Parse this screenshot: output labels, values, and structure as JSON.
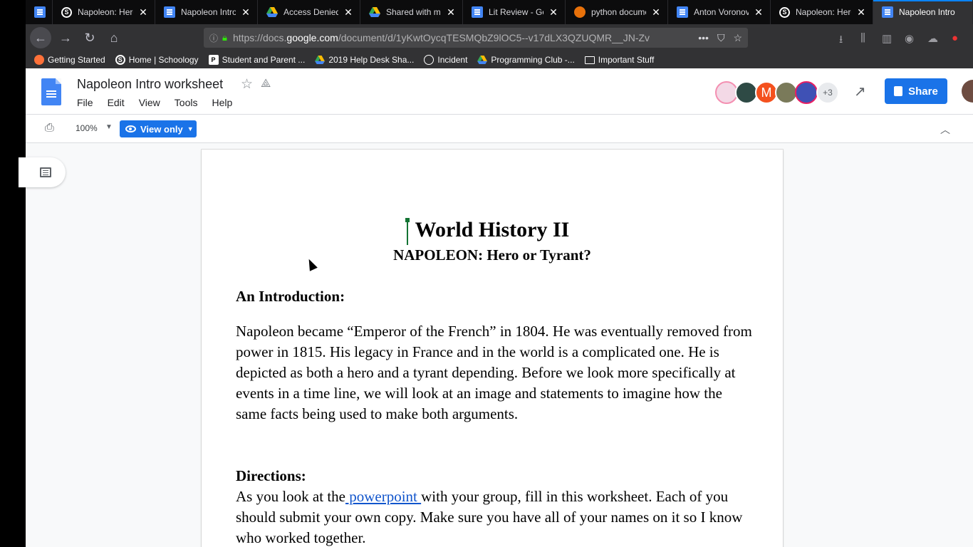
{
  "browser": {
    "tabs": [
      {
        "label": "",
        "icon": "docs-icon"
      },
      {
        "label": "Napoleon: Hero",
        "icon": "schoology-icon"
      },
      {
        "label": "Napoleon Intro",
        "icon": "docs-icon"
      },
      {
        "label": "Access Denied",
        "icon": "drive-icon"
      },
      {
        "label": "Shared with me",
        "icon": "drive-icon"
      },
      {
        "label": "Lit Review - Go",
        "icon": "docs-icon"
      },
      {
        "label": "python docume",
        "icon": "python-icon"
      },
      {
        "label": "Anton Voronov",
        "icon": "docs-icon"
      },
      {
        "label": "Napoleon: Hero",
        "icon": "schoology-icon"
      },
      {
        "label": "Napoleon Intro",
        "icon": "docs-icon"
      }
    ],
    "url_prefix": "https://docs.",
    "url_domain": "google.com",
    "url_rest": "/document/d/1yKwtOycqTESMQbZ9lOC5--v17dLX3QZUQMR__JN-Zv",
    "bookmarks": [
      "Getting Started",
      "Home | Schoology",
      "Student and Parent ...",
      "2019 Help Desk Sha...",
      "Incident",
      "Programming Club -...",
      "Important Stuff"
    ]
  },
  "docs": {
    "title": "Napoleon Intro worksheet",
    "menu": [
      "File",
      "Edit",
      "View",
      "Tools",
      "Help"
    ],
    "avatar_letter": "M",
    "more_collaborators": "+3",
    "share_label": "Share",
    "zoom": "100%",
    "mode_label": "View only"
  },
  "document": {
    "heading": "World History II",
    "subheading": "NAPOLEON: Hero or Tyrant?",
    "intro_heading": "An Introduction:",
    "intro_paragraph": "Napoleon became “Emperor of the French” in 1804. He was eventually removed from power in 1815. His legacy in France and in the world is a complicated one. He is depicted as both a hero and a tyrant depending. Before we look more specifically at events in a time line, we will look at an image and statements to imagine how the same facts being used to make both arguments.",
    "directions_heading": "Directions:",
    "directions_before": "As you  look at the",
    "directions_link": " powerpoint ",
    "directions_after": " with your group, fill in this worksheet. Each of you should submit your own copy. Make sure you have all of your names on it so I know who worked together."
  },
  "colors": {
    "accent": "#1a73e8",
    "link": "#1155cc",
    "cursor": "#137333"
  }
}
